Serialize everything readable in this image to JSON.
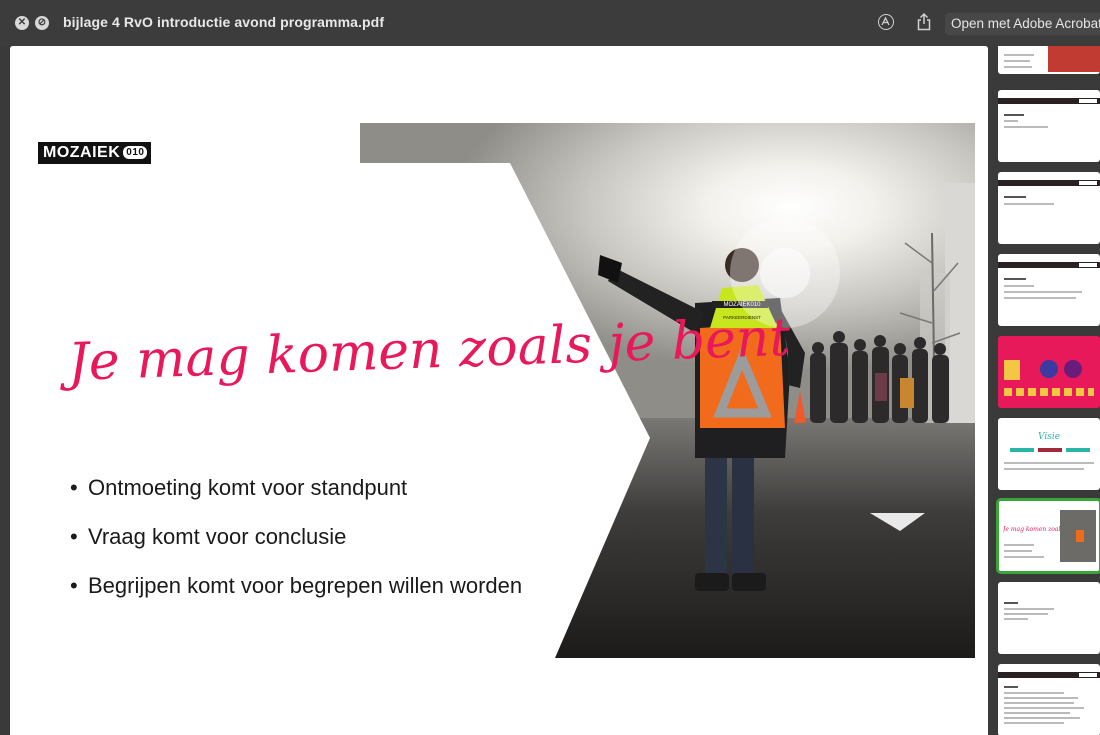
{
  "window": {
    "title": "bijlage 4 RvO introductie avond programma.pdf",
    "open_button_label": "Open met Adobe Acrobat"
  },
  "slide": {
    "logo_text": "MOZAIEK",
    "logo_badge": "010",
    "script_title": "Je mag komen zoals je bent",
    "bullets": [
      "Ontmoeting komt voor standpunt",
      "Vraag komt voor conclusie",
      "Begrijpen komt voor begrepen willen worden"
    ],
    "vest_text": "MOZAIEK010",
    "vest_subtext": "PARKEERDIENST"
  },
  "thumbnails": {
    "count": 9,
    "selected_index": 7,
    "vision_label": "Visie",
    "script_label": "Je mag komen zoals je bent"
  },
  "colors": {
    "accent_pink": "#e8195b",
    "selected_outline": "#3aa63a",
    "vest_orange": "#f26a1b",
    "vest_yellow": "#c8e61e"
  }
}
